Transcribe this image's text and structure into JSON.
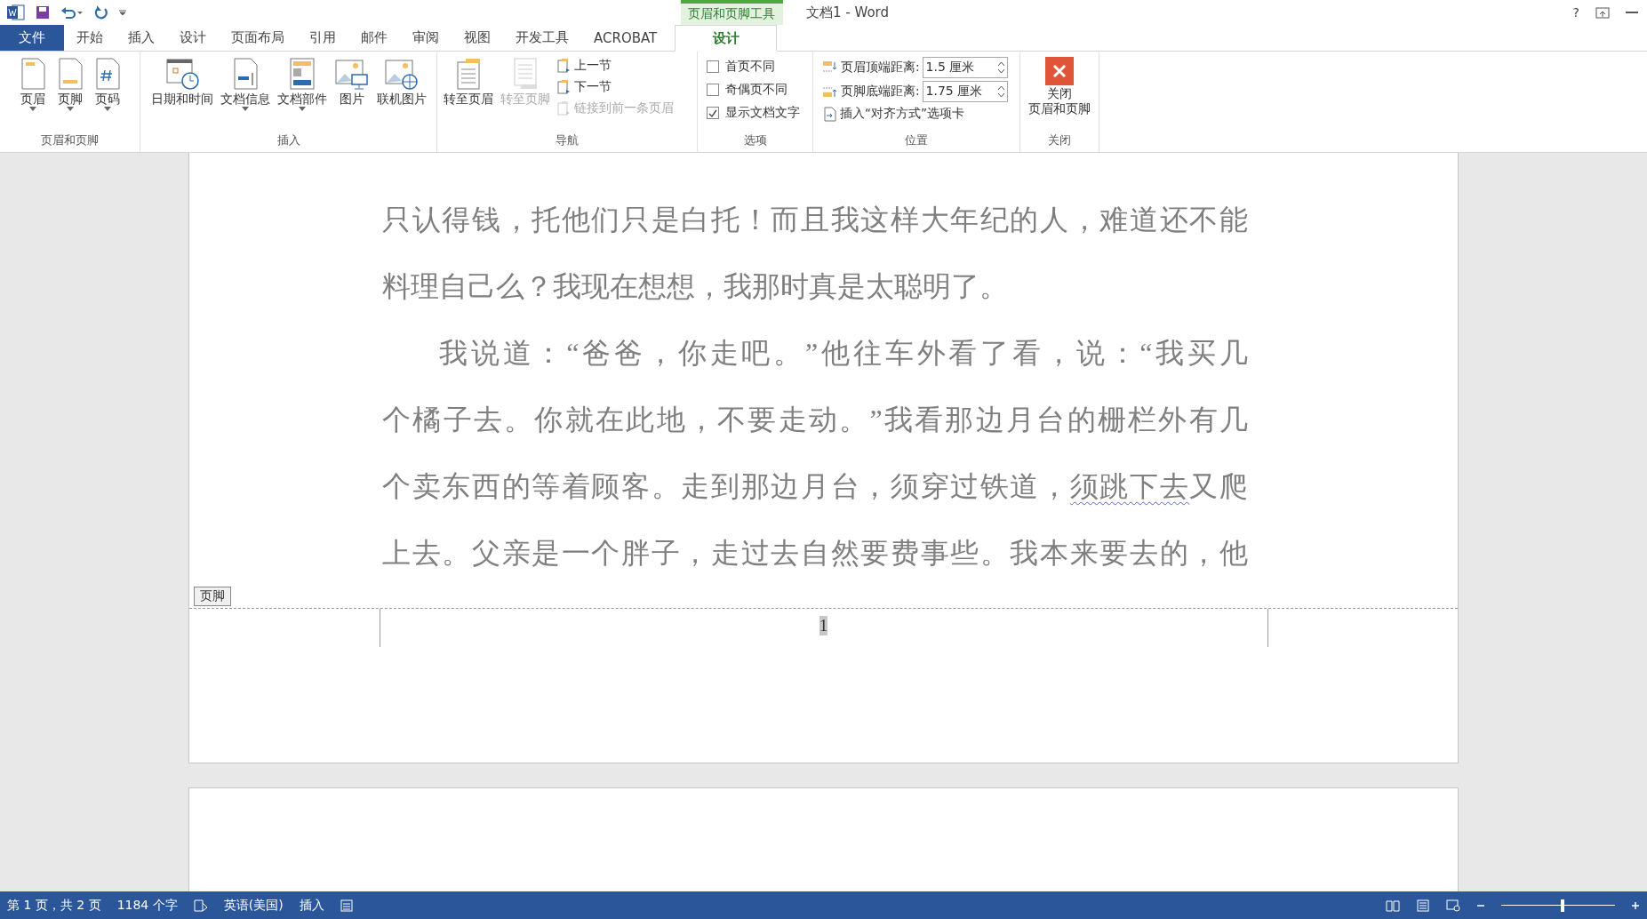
{
  "title_bar": {
    "context_tab": "页眉和页脚工具",
    "title": "文档1 - Word",
    "help": "?"
  },
  "tabs": [
    {
      "label": "文件",
      "kind": "file",
      "selected": false
    },
    {
      "label": "开始",
      "kind": "normal",
      "selected": false
    },
    {
      "label": "插入",
      "kind": "normal",
      "selected": false
    },
    {
      "label": "设计",
      "kind": "normal",
      "selected": false
    },
    {
      "label": "页面布局",
      "kind": "normal",
      "selected": false
    },
    {
      "label": "引用",
      "kind": "normal",
      "selected": false
    },
    {
      "label": "邮件",
      "kind": "normal",
      "selected": false
    },
    {
      "label": "审阅",
      "kind": "normal",
      "selected": false
    },
    {
      "label": "视图",
      "kind": "normal",
      "selected": false
    },
    {
      "label": "开发工具",
      "kind": "normal",
      "selected": false
    },
    {
      "label": "ACROBAT",
      "kind": "normal",
      "selected": false
    },
    {
      "label": "设计",
      "kind": "context",
      "selected": true
    }
  ],
  "ribbon": {
    "groups": [
      {
        "label": "页眉和页脚",
        "kind": "large",
        "items": [
          {
            "label": "页眉",
            "dropdown": true,
            "disabled": false
          },
          {
            "label": "页脚",
            "dropdown": true,
            "disabled": false
          },
          {
            "label": "页码",
            "dropdown": true,
            "disabled": false
          }
        ]
      },
      {
        "label": "插入",
        "kind": "large",
        "items": [
          {
            "label": "日期和时间",
            "dropdown": false,
            "disabled": false
          },
          {
            "label": "文档信息",
            "dropdown": true,
            "disabled": false
          },
          {
            "label": "文档部件",
            "dropdown": true,
            "disabled": false
          },
          {
            "label": "图片",
            "dropdown": false,
            "disabled": false
          },
          {
            "label": "联机图片",
            "dropdown": false,
            "disabled": false
          }
        ]
      },
      {
        "label": "导航",
        "kind": "nav",
        "items": [
          {
            "label": "转至页眉",
            "disabled": false
          },
          {
            "label": "转至页脚",
            "disabled": true
          }
        ],
        "small": [
          {
            "label": "上一节",
            "disabled": false
          },
          {
            "label": "下一节",
            "disabled": false
          },
          {
            "label": "链接到前一条页眉",
            "disabled": true
          }
        ]
      },
      {
        "label": "选项",
        "kind": "checks",
        "checks": [
          {
            "label": "首页不同",
            "checked": false
          },
          {
            "label": "奇偶页不同",
            "checked": false
          },
          {
            "label": "显示文档文字",
            "checked": true
          }
        ]
      },
      {
        "label": "位置",
        "kind": "position",
        "spinners": [
          {
            "label": "页眉顶端距离:",
            "value": "1.5 厘米"
          },
          {
            "label": "页脚底端距离:",
            "value": "1.75 厘米"
          }
        ],
        "link": "插入“对齐方式”选项卡"
      },
      {
        "label": "关闭",
        "kind": "close",
        "button": [
          "关闭",
          "页眉和页脚"
        ]
      }
    ]
  },
  "document": {
    "lines": [
      {
        "indent": false,
        "segments": [
          {
            "text": "只认得钱，托他们只是白托！而且我这样大年纪的人，难道还不能",
            "flagged": false
          }
        ]
      },
      {
        "indent": false,
        "last": true,
        "segments": [
          {
            "text": "料理自己么？我现在想想，我那时真是太聪明了。",
            "flagged": false
          }
        ]
      },
      {
        "indent": true,
        "segments": [
          {
            "text": "我说道：“爸爸，你走吧。”他往车外看了看，说：“我买几",
            "flagged": false
          }
        ]
      },
      {
        "indent": false,
        "segments": [
          {
            "text": "个橘子去。你就在此地，不要走动。”我看那边月台的栅栏外有几",
            "flagged": false
          }
        ]
      },
      {
        "indent": false,
        "segments": [
          {
            "text": "个卖东西的等着顾客。走到那边月台，须穿过铁道，",
            "flagged": false
          },
          {
            "text": "须跳下去",
            "flagged": true
          },
          {
            "text": "又爬",
            "flagged": false
          }
        ]
      },
      {
        "indent": false,
        "segments": [
          {
            "text": "上去。父亲是一个胖子，走过去自然要费事些。我本来要去的，他",
            "flagged": false
          }
        ]
      }
    ],
    "footer_tag": "页脚",
    "page_number": "1"
  },
  "status_bar": {
    "page": "第 1 页，共 2 页",
    "words": "1184 个字",
    "language": "英语(美国)",
    "mode": "插入",
    "zoom": {
      "level": 0.54
    }
  }
}
